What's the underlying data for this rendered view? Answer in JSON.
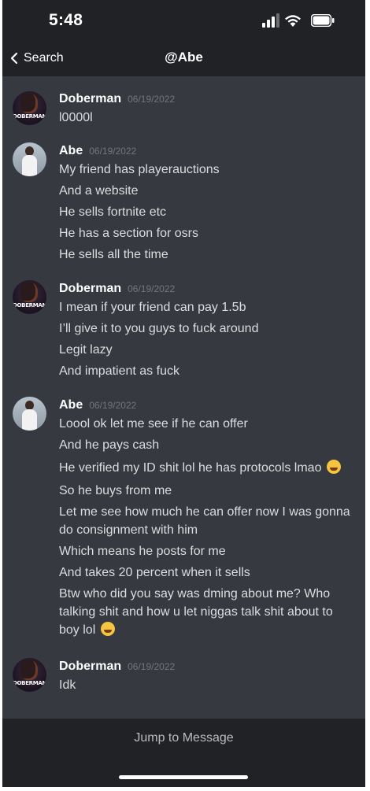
{
  "status_bar": {
    "time": "5:48"
  },
  "nav": {
    "back_label": "Search",
    "title": "@Abe"
  },
  "avatars": {
    "doberman_text": "DOBERMAN"
  },
  "messages": [
    {
      "author": "Doberman",
      "timestamp": "06/19/2022",
      "lines": [
        "l0000l"
      ]
    },
    {
      "author": "Abe",
      "timestamp": "06/19/2022",
      "lines": [
        "My friend has playerauctions",
        "And a website",
        "He sells fortnite etc",
        "He has a section for osrs",
        "He sells all the time"
      ]
    },
    {
      "author": "Doberman",
      "timestamp": "06/19/2022",
      "lines": [
        "I mean if your friend can pay 1.5b",
        "I’ll give it to you guys to fuck around",
        "Legit lazy",
        "And impatient as fuck"
      ]
    },
    {
      "author": "Abe",
      "timestamp": "06/19/2022",
      "lines": [
        "Loool ok let me see if he can offer",
        "And he pays cash",
        "He  verified my ID shit lol he has protocols lmao",
        "So he buys from me",
        "Let me see how much he can offer now I was gonna do consignment with him",
        "Which means he posts for me",
        "And takes 20 percent when it sells",
        "Btw who did you say was dming about me? Who talking shit and how u let niggas talk shit about to boy lol"
      ]
    },
    {
      "author": "Doberman",
      "timestamp": "06/19/2022",
      "lines": [
        "Idk"
      ]
    }
  ],
  "bottom": {
    "jump_label": "Jump to Message"
  },
  "colors": {
    "background": "#36393f",
    "bars": "#202225",
    "text": "#dcddde",
    "timestamp": "#72767d"
  }
}
